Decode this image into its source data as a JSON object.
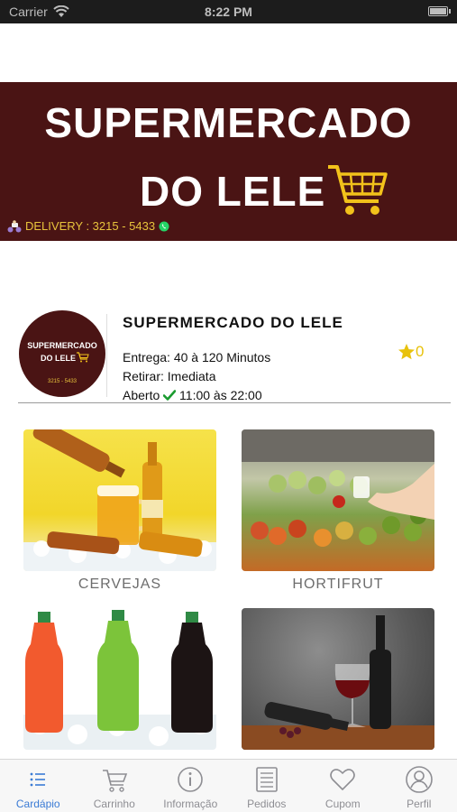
{
  "status_bar": {
    "carrier": "Carrier",
    "time": "8:22 PM"
  },
  "banner": {
    "title_line1": "SUPERMERCADO",
    "title_line2": "DO LELE",
    "delivery": "DELIVERY : 3215 - 5433"
  },
  "store": {
    "logo": {
      "line1": "SUPERMERCADO",
      "line2": "DO LELE",
      "phone": "3215 - 5433"
    },
    "name": "SUPERMERCADO DO LELE",
    "delivery_time": "Entrega: 40 à 120 Minutos",
    "pickup": "Retirar: Imediata",
    "open_label": "Aberto",
    "hours": "11:00 às 22:00",
    "rating": "0"
  },
  "categories": [
    {
      "label": "CERVEJAS"
    },
    {
      "label": "HORTIFRUT"
    },
    {
      "label": ""
    },
    {
      "label": ""
    }
  ],
  "tabs": [
    {
      "label": "Cardápio",
      "icon": "list-icon"
    },
    {
      "label": "Carrinho",
      "icon": "cart-icon"
    },
    {
      "label": "Informação",
      "icon": "info-icon"
    },
    {
      "label": "Pedidos",
      "icon": "orders-icon"
    },
    {
      "label": "Cupom",
      "icon": "heart-icon"
    },
    {
      "label": "Perfil",
      "icon": "profile-icon"
    }
  ],
  "colors": {
    "brand": "#4a1414",
    "accent": "#3a7bd5",
    "star": "#e8c20c",
    "gold": "#e8c43c"
  }
}
